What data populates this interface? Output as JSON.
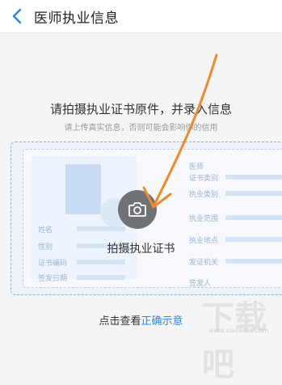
{
  "header": {
    "title": "医师执业信息",
    "back_icon": "chevron-left-icon"
  },
  "instructions": {
    "main": "请拍摄执业证书原件，并录入信息",
    "sub": "请上传真实信息，否则可能会影响你的信用"
  },
  "certificate": {
    "left_fields": [
      "姓名",
      "性别",
      "证书编码",
      "签发日期"
    ],
    "right_fields": [
      "医师",
      "证书类别",
      "执业类别",
      "执业范围",
      "执业地点",
      "发证机关",
      "签发人"
    ]
  },
  "capture": {
    "icon": "camera-icon",
    "label": "拍摄执业证书"
  },
  "footer": {
    "prefix": "点击查看",
    "link": "正确示意"
  },
  "watermark": {
    "text": "下载吧",
    "url": "www.xiazaiba.com"
  },
  "colors": {
    "accent": "#2f86e6",
    "annotation_arrow": "#f08a2a"
  }
}
